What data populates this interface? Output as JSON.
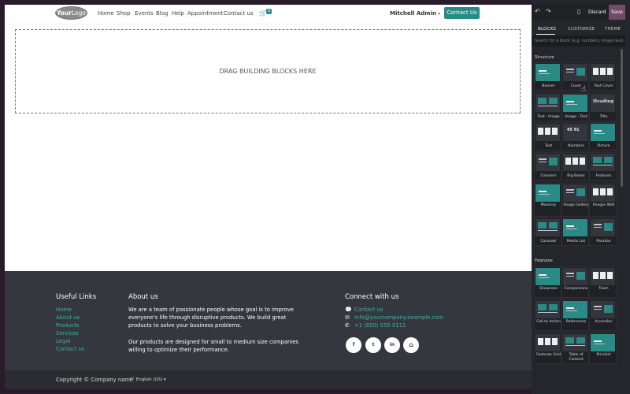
{
  "navbar": {
    "logo_a": "Your",
    "logo_b": "Logo",
    "links": [
      "Home",
      "Shop",
      "Events",
      "Blog",
      "Help",
      "Appointment",
      "Contact us"
    ],
    "cart_count": "0",
    "user": "Mitchell Admin",
    "contact_button": "Contact Us"
  },
  "dropzone": {
    "text": "DRAG BUILDING BLOCKS HERE"
  },
  "footer": {
    "useful_links_title": "Useful Links",
    "useful_links": [
      "Home",
      "About us",
      "Products",
      "Services",
      "Legal",
      "Contact us"
    ],
    "about_title": "About us",
    "about_p1": "We are a team of passionate people whose goal is to improve everyone's life through disruptive products. We build great products to solve your business problems.",
    "about_p2": "Our products are designed for small to medium size companies willing to optimize their performance.",
    "connect_title": "Connect with us",
    "connect": [
      "Contact us",
      "info@yourcompany.example.com",
      "+1 (650) 555-0111"
    ],
    "social": [
      "f",
      "t",
      "in",
      "home"
    ],
    "copyright": "Copyright © Company name",
    "language": "English (US)"
  },
  "editor": {
    "discard": "Discard",
    "save": "Save",
    "tabs": [
      "BLOCKS",
      "CUSTOMIZE",
      "THEME"
    ],
    "search_placeholder": "Search for a block (e.g. numbers, image wall, ...)",
    "sections": [
      "Structure",
      "Features"
    ],
    "structure_blocks": [
      "Banner",
      "Cover",
      "Text Cover",
      "Text - Image",
      "Image - Text",
      "Title",
      "Text",
      "Numbers",
      "Picture",
      "Columns",
      "Big Boxes",
      "Features",
      "Masonry",
      "Image Gallery",
      "Images Wall",
      "Carousel",
      "Media List",
      "Parallax"
    ],
    "feature_blocks": [
      "Showcase",
      "Comparisons",
      "Team",
      "Call to Action",
      "References",
      "Accordion",
      "Features Grid",
      "Table of Content",
      "Pricelist"
    ],
    "title_thumb_text": "Heading",
    "numbers_thumb_text": "45 91"
  }
}
